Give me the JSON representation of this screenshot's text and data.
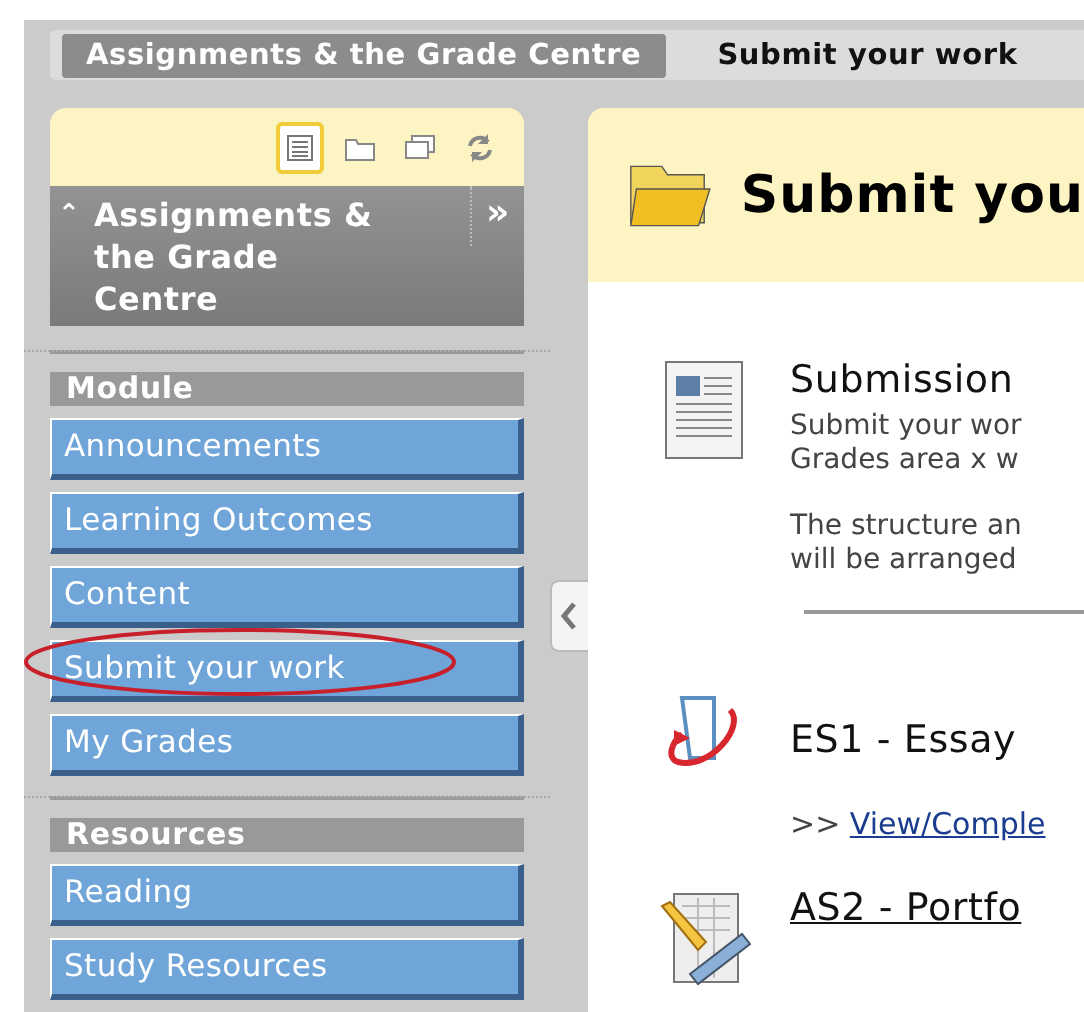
{
  "breadcrumbs": [
    {
      "label": "Assignments & the Grade Centre",
      "selected": false
    },
    {
      "label": "Submit your work",
      "selected": true
    }
  ],
  "toolbar": [
    {
      "kind": "list",
      "selected": true
    },
    {
      "kind": "folder",
      "selected": false
    },
    {
      "kind": "windows",
      "selected": false
    },
    {
      "kind": "refresh",
      "selected": false
    }
  ],
  "course_title": "Assignments & the Grade Centre",
  "collapse_symbol": "⌃",
  "expand_symbol": "»",
  "menu_sections": [
    {
      "heading": "Module",
      "items": [
        {
          "label": "Announcements",
          "circled": false
        },
        {
          "label": "Learning Outcomes",
          "circled": false
        },
        {
          "label": "Content",
          "circled": false
        },
        {
          "label": "Submit your work",
          "circled": true
        },
        {
          "label": "My Grades",
          "circled": false
        }
      ]
    },
    {
      "heading": "Resources",
      "items": [
        {
          "label": "Reading",
          "circled": false
        },
        {
          "label": "Study Resources",
          "circled": false
        }
      ]
    }
  ],
  "page_title": "Submit you",
  "content_items": [
    {
      "kind": "document",
      "title": "Submission",
      "title_link": false,
      "paragraphs": [
        [
          "Submit your wor",
          "Grades area x w"
        ],
        [
          "The structure an",
          "will be arranged"
        ]
      ]
    },
    {
      "kind": "assignment",
      "title": "ES1 - Essay",
      "title_link": false,
      "link_prefix": ">>",
      "link": "View/Comple"
    },
    {
      "kind": "rubric",
      "title": "AS2 - Portfo",
      "title_link": true
    }
  ]
}
